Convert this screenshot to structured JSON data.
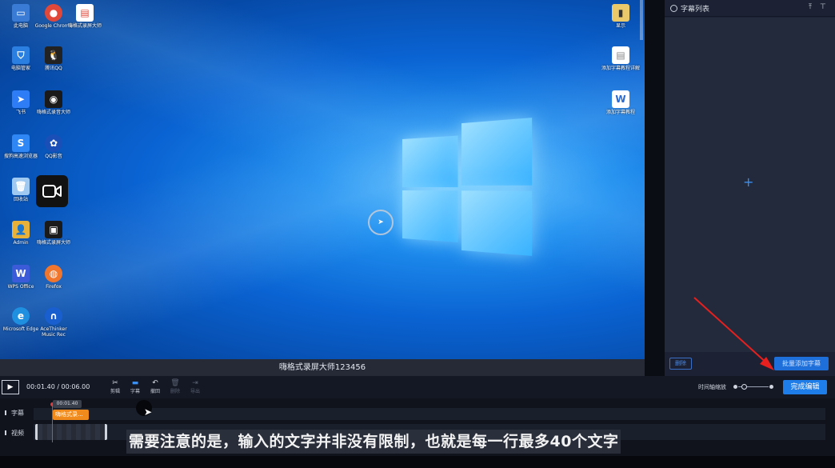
{
  "desktop": {
    "icons_left": [
      {
        "label": "此电脑",
        "color": "#3a7bd5",
        "glyph": "▭"
      },
      {
        "label": "Google Chrome",
        "color": "#e0483a",
        "glyph": "●"
      },
      {
        "label": "嗨格式录屏大师",
        "color": "#ffffff",
        "glyph": "▤"
      },
      {
        "label": "电脑管家",
        "color": "#2b7fe0",
        "glyph": "⛉"
      },
      {
        "label": "腾讯QQ",
        "color": "#222222",
        "glyph": "🐧"
      },
      {
        "label": "飞书",
        "color": "#2f7df6",
        "glyph": "➤"
      },
      {
        "label": "嗨格式录音大师",
        "color": "#1a1a1a",
        "glyph": "◉"
      },
      {
        "label": "搜狗高速浏览器",
        "color": "#2f86f5",
        "glyph": "S"
      },
      {
        "label": "QQ影音",
        "color": "#1a4fb8",
        "glyph": "✿"
      },
      {
        "label": "回收站",
        "color": "#9fc9f0",
        "glyph": "🗑"
      },
      {
        "label": "Admin",
        "color": "#e8b23a",
        "glyph": "👤"
      },
      {
        "label": "嗨格式录屏大师",
        "color": "#1a1a1a",
        "glyph": "▣"
      },
      {
        "label": "WPS Office",
        "color": "#3b5bd9",
        "glyph": "W"
      },
      {
        "label": "Firefox",
        "color": "#f0762d",
        "glyph": "◍"
      },
      {
        "label": "Microsoft Edge",
        "color": "#1f8fe0",
        "glyph": "e"
      },
      {
        "label": "AceThinker Music Rec",
        "color": "#1a5fd0",
        "glyph": "∩"
      }
    ],
    "icons_right": [
      {
        "label": "显示",
        "color": "#e9c96a",
        "glyph": "▮"
      },
      {
        "label": "添加字幕教程详解",
        "color": "#ffffff",
        "glyph": "▤"
      },
      {
        "label": "添加字幕教程",
        "color": "#2b6ad0",
        "glyph": "W"
      }
    ]
  },
  "caption_bar": {
    "text": "嗨格式录屏大师123456"
  },
  "right_panel": {
    "title": "字幕列表",
    "upload_icon": "upload-icon",
    "align_top_icon": "align-top-icon",
    "add_glyph": "+",
    "delete_label": "删除",
    "batch_add_label": "批量添加字幕"
  },
  "toolbar": {
    "time": "00:01.40 / 00:06.00",
    "tools": [
      {
        "label": "剪辑",
        "icon": "✂",
        "name": "cut"
      },
      {
        "label": "字幕",
        "icon": "▬",
        "name": "subtitle"
      },
      {
        "label": "撤回",
        "icon": "↶",
        "name": "undo"
      },
      {
        "label": "删除",
        "icon": "🗑",
        "name": "delete"
      },
      {
        "label": "导出",
        "icon": "⇥",
        "name": "export"
      }
    ],
    "zoom_label": "时间轴缩放",
    "finish_label": "完成编辑"
  },
  "timeline": {
    "playhead_time": "00:01.40",
    "subtitle_track_label": "字幕",
    "video_track_label": "视频",
    "subtitle_clip_text": "嗨格式录..."
  },
  "overlay_subtitle": "需要注意的是，输入的文字并非没有限制，也就是每一行最多40个文字"
}
